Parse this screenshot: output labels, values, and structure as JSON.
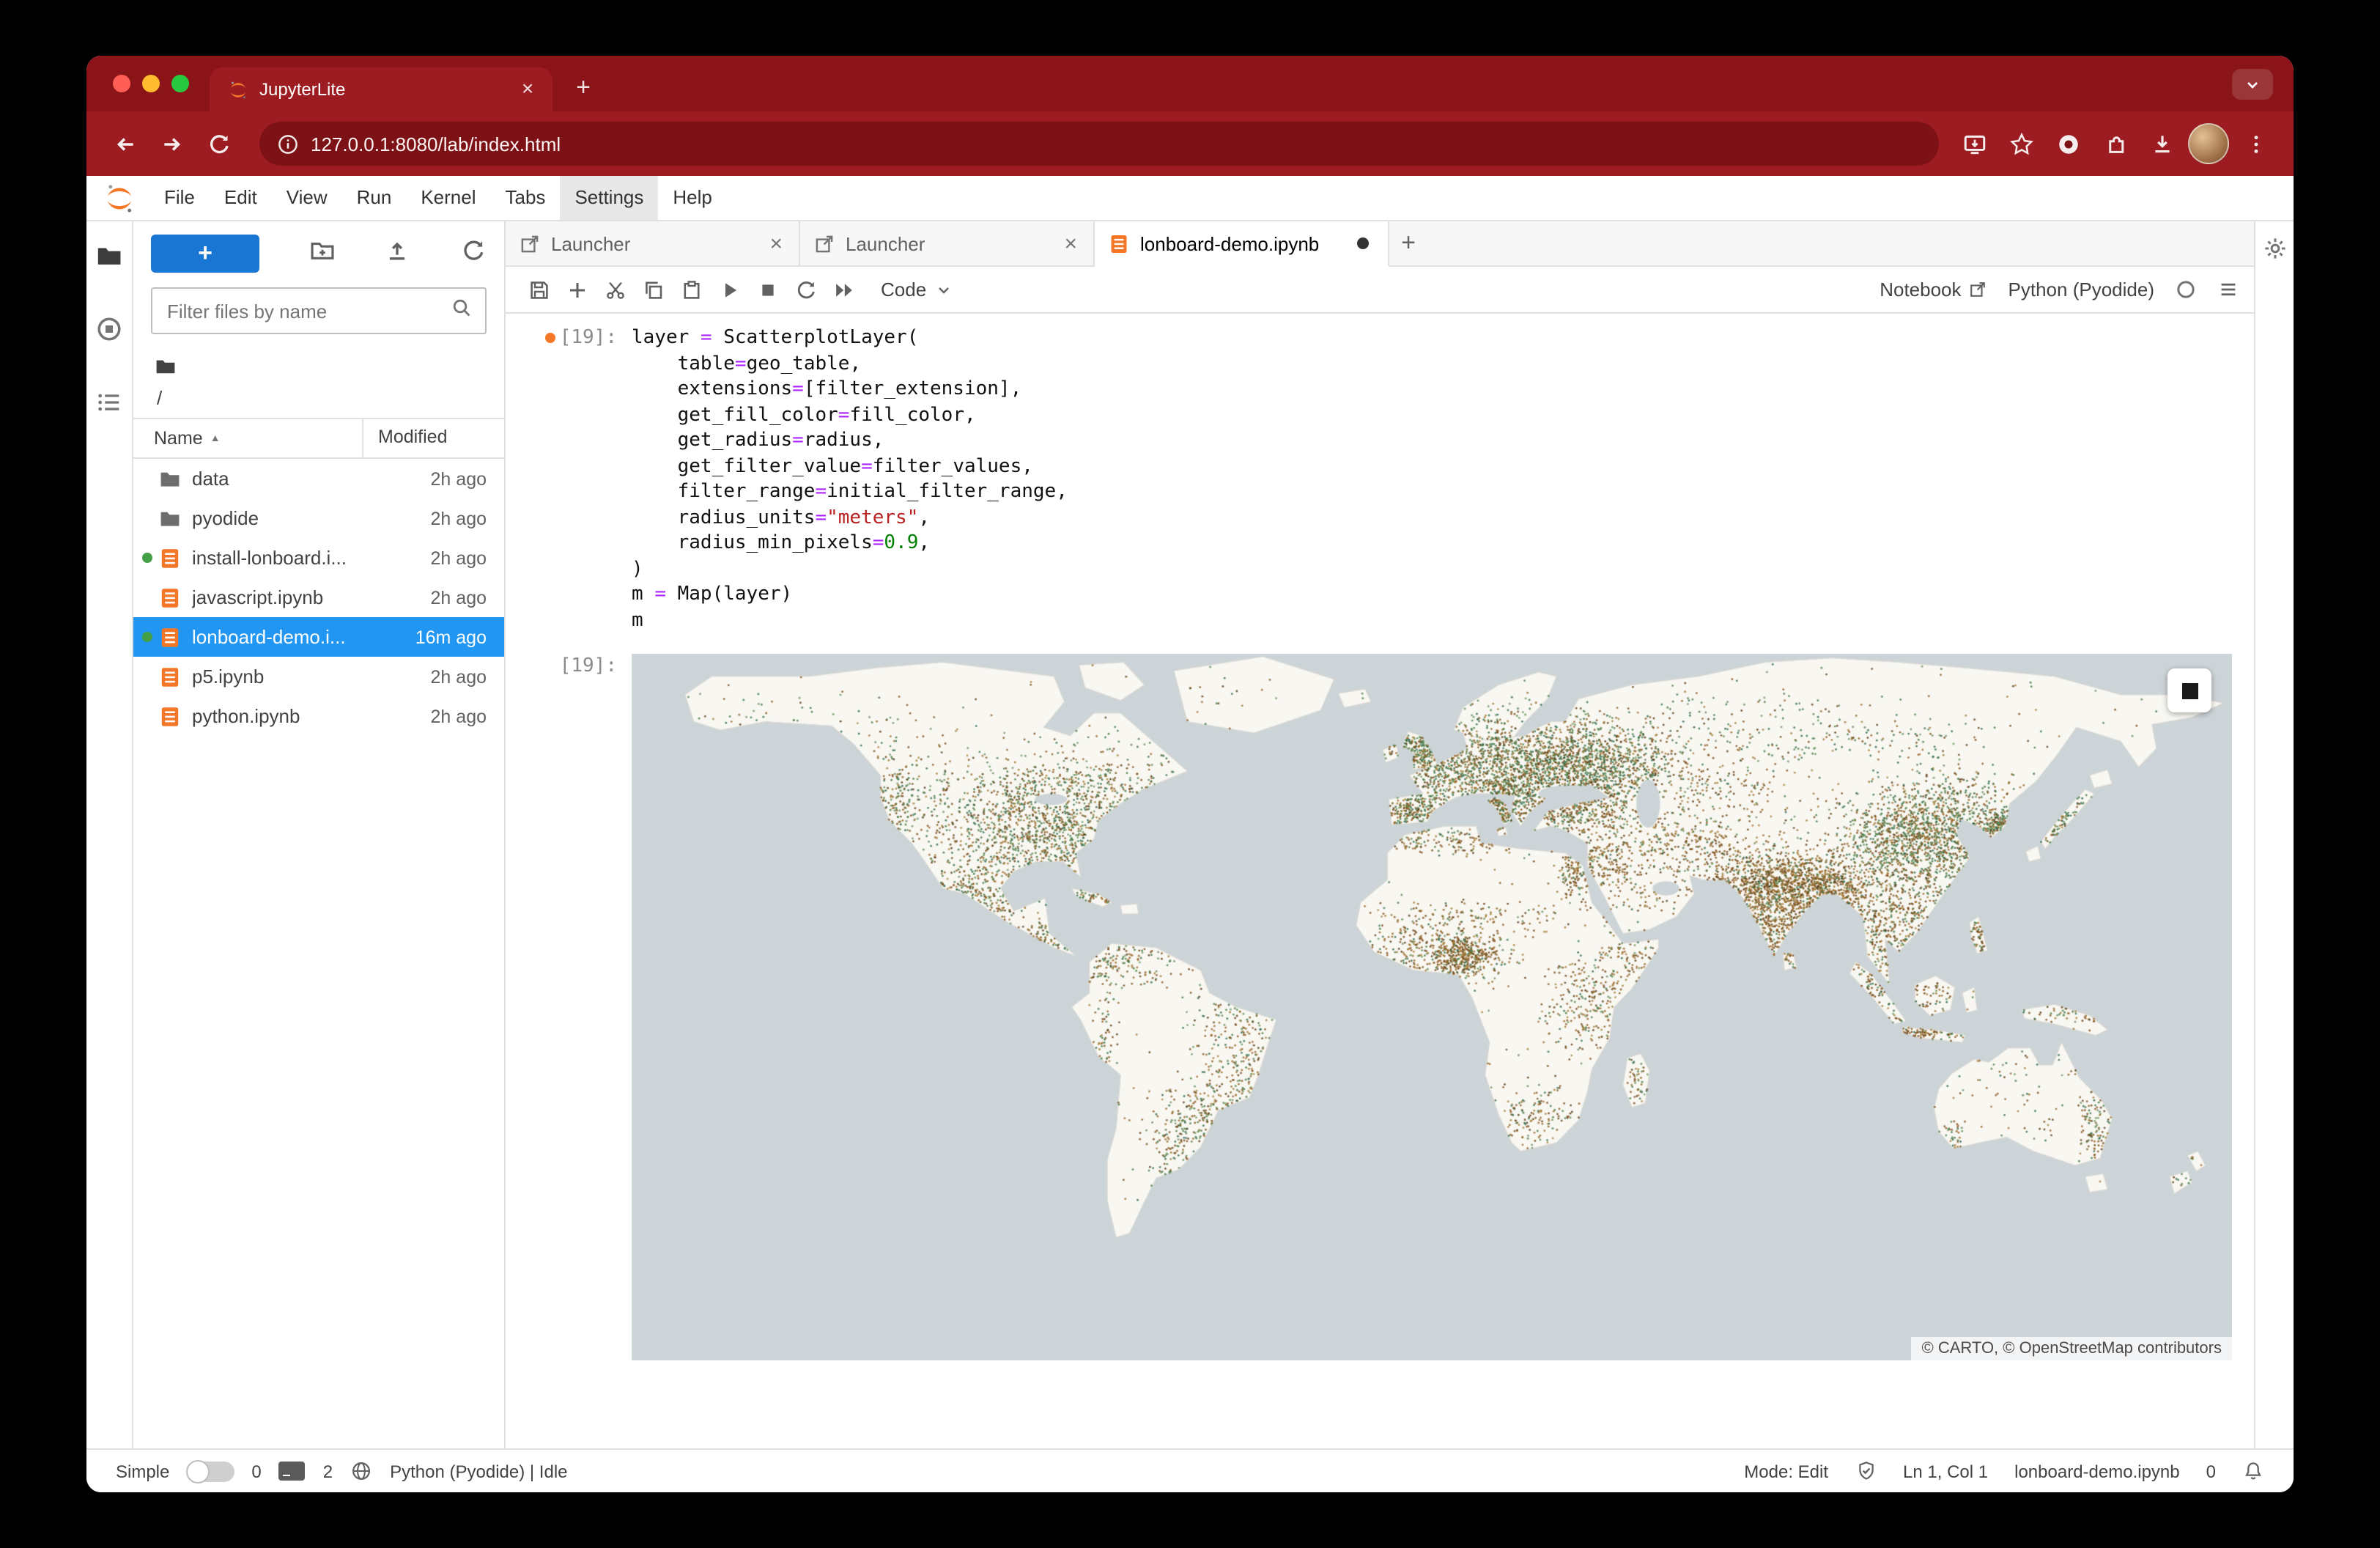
{
  "colors": {
    "chrome_red": "#9d1c21",
    "chrome_tabstrip_red": "#8a1418",
    "url_bar_red": "#7c1116",
    "accent_blue": "#1976d2",
    "selection_blue": "#2196f3",
    "jupyter_orange": "#f37726",
    "running_green": "#43a047",
    "map_ocean": "#cdd4d8",
    "map_land": "#f8f7f2",
    "dot_green": "#4a7a44",
    "dot_brown": "#8a5a22"
  },
  "browser": {
    "tab_title": "JupyterLite",
    "url": "127.0.0.1:8080/lab/index.html"
  },
  "menu_bar": {
    "items": [
      "File",
      "Edit",
      "View",
      "Run",
      "Kernel",
      "Tabs",
      "Settings",
      "Help"
    ],
    "active": "Settings"
  },
  "sidebar": {
    "new_button_label": "+",
    "filter_placeholder": "Filter files by name",
    "breadcrumb": "/",
    "header": {
      "name": "Name",
      "modified": "Modified"
    },
    "files": [
      {
        "name": "data",
        "type": "folder",
        "modified": "2h ago",
        "running": false,
        "selected": false
      },
      {
        "name": "pyodide",
        "type": "folder",
        "modified": "2h ago",
        "running": false,
        "selected": false
      },
      {
        "name": "install-lonboard.i...",
        "type": "notebook",
        "modified": "2h ago",
        "running": true,
        "selected": false
      },
      {
        "name": "javascript.ipynb",
        "type": "notebook",
        "modified": "2h ago",
        "running": false,
        "selected": false
      },
      {
        "name": "lonboard-demo.i...",
        "type": "notebook",
        "modified": "16m ago",
        "running": true,
        "selected": true
      },
      {
        "name": "p5.ipynb",
        "type": "notebook",
        "modified": "2h ago",
        "running": false,
        "selected": false
      },
      {
        "name": "python.ipynb",
        "type": "notebook",
        "modified": "2h ago",
        "running": false,
        "selected": false
      }
    ]
  },
  "dock": {
    "tabs": [
      {
        "label": "Launcher",
        "kind": "launcher",
        "active": false,
        "dirty": false
      },
      {
        "label": "Launcher",
        "kind": "launcher",
        "active": false,
        "dirty": false
      },
      {
        "label": "lonboard-demo.ipynb",
        "kind": "notebook",
        "active": true,
        "dirty": true
      }
    ],
    "add_tab_label": "+"
  },
  "notebook_toolbar": {
    "cell_type": "Code",
    "notebook_label": "Notebook",
    "kernel_name": "Python (Pyodide)"
  },
  "cell": {
    "input_prompt": "[19]:",
    "output_prompt": "[19]:",
    "code_lines": [
      [
        {
          "x": "layer "
        },
        {
          "x": "=",
          "c": "op"
        },
        {
          "x": " ScatterplotLayer("
        }
      ],
      [
        {
          "x": "    table"
        },
        {
          "x": "=",
          "c": "op"
        },
        {
          "x": "geo_table,"
        }
      ],
      [
        {
          "x": "    extensions"
        },
        {
          "x": "=",
          "c": "op"
        },
        {
          "x": "[filter_extension],"
        }
      ],
      [
        {
          "x": "    get_fill_color"
        },
        {
          "x": "=",
          "c": "op"
        },
        {
          "x": "fill_color,"
        }
      ],
      [
        {
          "x": "    get_radius"
        },
        {
          "x": "=",
          "c": "op"
        },
        {
          "x": "radius,"
        }
      ],
      [
        {
          "x": "    get_filter_value"
        },
        {
          "x": "=",
          "c": "op"
        },
        {
          "x": "filter_values,"
        }
      ],
      [
        {
          "x": "    filter_range"
        },
        {
          "x": "=",
          "c": "op"
        },
        {
          "x": "initial_filter_range,"
        }
      ],
      [
        {
          "x": "    radius_units"
        },
        {
          "x": "=",
          "c": "op"
        },
        {
          "x": "\"meters\"",
          "c": "str"
        },
        {
          "x": ","
        }
      ],
      [
        {
          "x": "    radius_min_pixels"
        },
        {
          "x": "=",
          "c": "op"
        },
        {
          "x": "0.9",
          "c": "num"
        },
        {
          "x": ","
        }
      ],
      [
        {
          "x": ")"
        }
      ],
      [
        {
          "x": "m "
        },
        {
          "x": "=",
          "c": "op"
        },
        {
          "x": " Map(layer)"
        }
      ],
      [
        {
          "x": "m"
        }
      ]
    ]
  },
  "map": {
    "attribution": "© CARTO, © OpenStreetMap contributors"
  },
  "status_bar": {
    "simple_label": "Simple",
    "kernel_count": "0",
    "terminal_count": "2",
    "kernel_status": "Python (Pyodide) | Idle",
    "mode": "Mode: Edit",
    "cursor": "Ln 1, Col 1",
    "filename": "lonboard-demo.ipynb",
    "notification_count": "0"
  }
}
